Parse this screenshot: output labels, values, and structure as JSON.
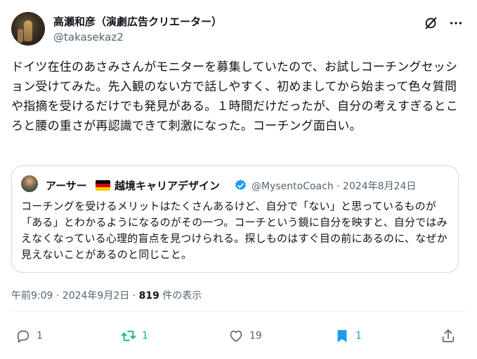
{
  "author": {
    "display_name": "高瀬和彦（演劇広告クリエーター）",
    "handle": "@takasekaz2"
  },
  "tweet": {
    "text": "ドイツ在住のあさみさんがモニターを募集していたので、お試しコーチングセッション受けてみた。先入観のない方で話しやすく、初めましてから始まって色々質問や指摘を受けるだけでも発見がある。１時間だけだったが、自分の考えすぎるところと腰の重さが再認識できて刺激になった。コーチング面白い。"
  },
  "quote": {
    "name_part1": "アーサー",
    "flag_icon": "germany-flag-icon",
    "name_part2": "越境キャリアデザイン",
    "meta": "@MysentoCoach · 2024年8月24日",
    "text": "コーチングを受けるメリットはたくさんあるけど、自分で「ない」と思っているものが「ある」とわかるようになるのがその一つ。コーチという鏡に自分を映すと、自分ではみえなくなっている心理的盲点を見つけられる。探しものはすぐ目の前にあるのに、なぜか見えないことがあるのと同じこと。"
  },
  "meta": {
    "time": "午前9:09 · 2024年9月2日 · ",
    "views": "819",
    "views_suffix": " 件の表示"
  },
  "actions": {
    "reply_count": "1",
    "retweet_count": "1",
    "like_count": "19",
    "bookmark_count": "1"
  },
  "colors": {
    "retweeted": "#00ba7c",
    "bookmarked": "#1d9bf0",
    "secondary_text": "#536471",
    "verified": "#1d9bf0"
  }
}
